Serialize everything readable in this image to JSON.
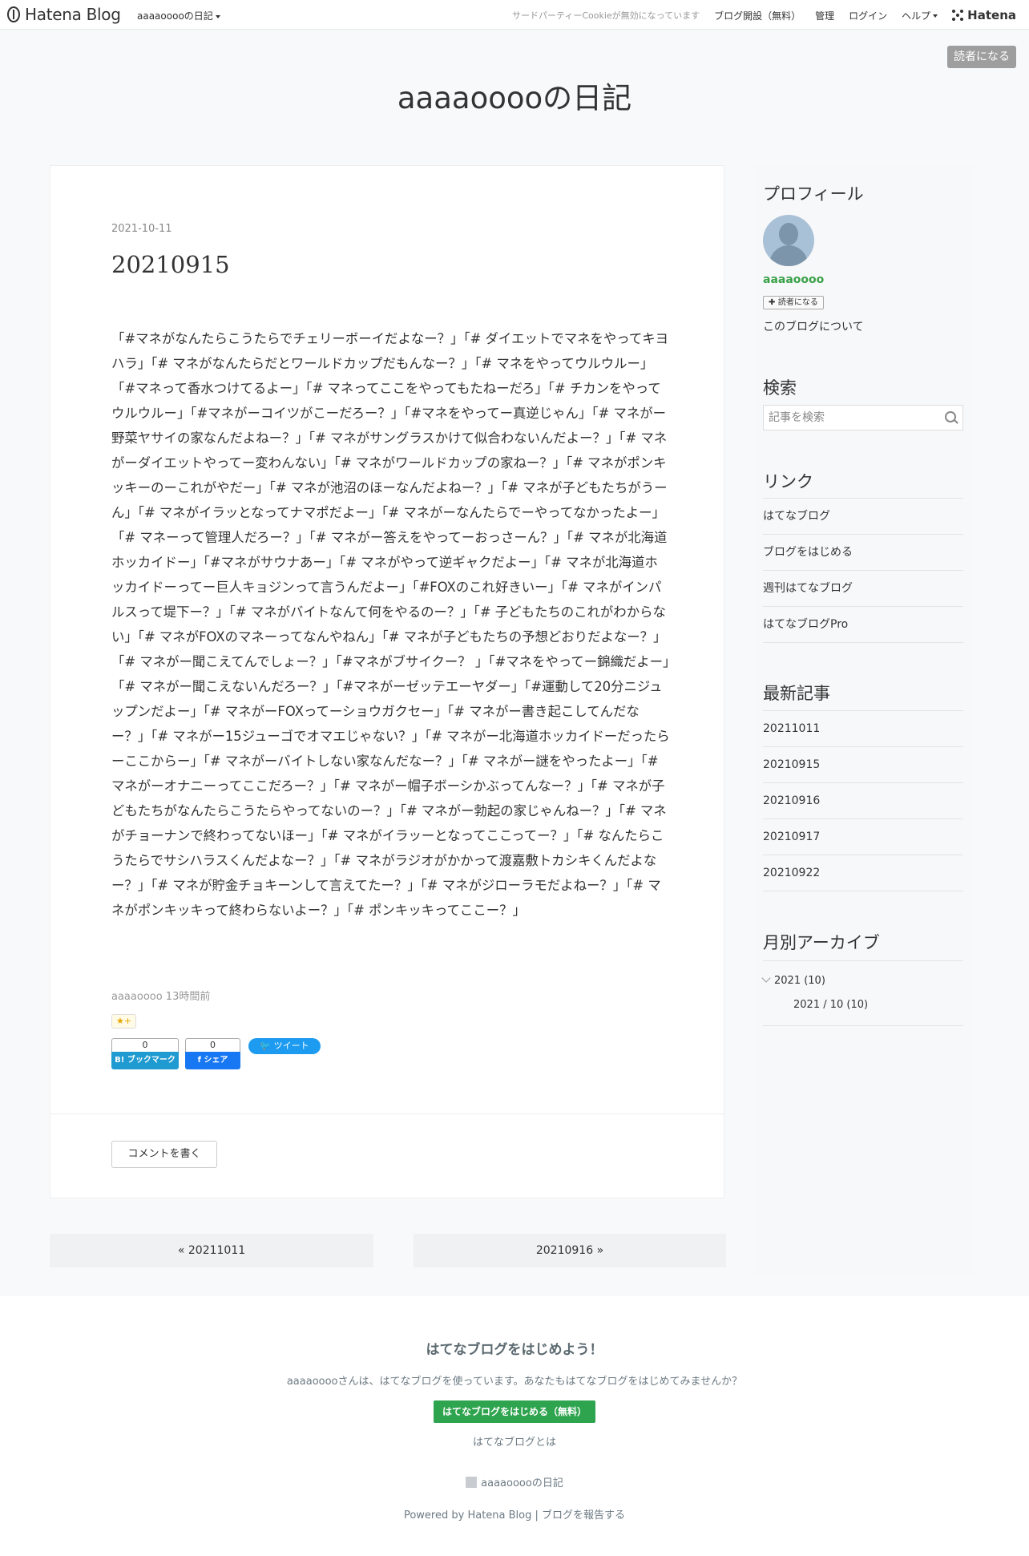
{
  "header": {
    "logo_text": "Hatena Blog",
    "blog_menu": "aaaaooooの日記",
    "cookie_notice": "サードパーティーCookieが無効になっています",
    "start_blog": "ブログ開設（無料）",
    "admin": "管理",
    "login": "ログイン",
    "help": "ヘルプ",
    "hatena": "Hatena"
  },
  "blog": {
    "title": "aaaaooooの日記",
    "subscribe_label": "読者になる"
  },
  "entry": {
    "date": "2021-10-11",
    "title": "20210915",
    "body": "「#マネがなんたらこうたらでチェリーボーイだよなー？」「# ダイエットでマネをやってキヨハラ」「# マネがなんたらだとワールドカップだもんなー？」「# マネをやってウルウルー」「#マネって香水つけてるよー」「# マネってここをやってもたねーだろ」「# チカンをやってウルウルー」「#マネがーコイツがこーだろー？」「#マネをやってー真逆じゃん」「# マネがー野菜ヤサイの家なんだよねー？」「# マネがサングラスかけて似合わないんだよー？」「# マネがーダイエットやってー変わんない」「# マネがワールドカップの家ねー？」「# マネがポンキッキーのーこれがやだー」「# マネが池沼のほーなんだよねー？」「# マネが子どもたちがうーん」「# マネがイラッとなってナマポだよー」「# マネがーなんたらでーやってなかったよー」「# マネーって管理人だろー？」「# マネがー答えをやってーおっさーん？」「# マネが北海道ホッカイドー」「#マネがサウナあー」「# マネがやって逆ギャクだよー」「# マネが北海道ホッカイドーってー巨人キョジンって言うんだよー」「#FOXのこれ好きいー」「# マネがインパルスって堤下ー？」「# マネがバイトなんて何をやるのー？」「# 子どもたちのこれがわからない」「# マネがFOXのマネーってなんやねん」「# マネが子どもたちの予想どおりだよなー？」「# マネがー聞こえてんでしょー？」「#マネがブサイクー？ 」「#マネをやってー錦織だよー」「# マネがー聞こえないんだろー？」「#マネがーゼッテエーヤダー」「#運動して20分ニジュップンだよー」「# マネがーFOXってーショウガクセー」「# マネがー書き起こしてんだなー？」「# マネがー15ジューゴでオマエじゃない？」「# マネがー北海道ホッカイドーだったらーここからー」「# マネがーバイトしない家なんだなー？」「# マネがー謎をやったよー」「# マネがーオナニーってここだろー？」「# マネがー帽子ボーシかぶってんなー？」「# マネが子どもたちがなんたらこうたらやってないのー？」「# マネがー勃起の家じゃんねー？」「# マネがチョーナンで終わってないほー」「# マネがイラッーとなってここってー？」「# なんたらこうたらでサシハラスくんだよなー？」「# マネがラジオがかかって渡嘉敷トカシキくんだよなー？」「# マネが貯金チョキーンして言えてたー？」「# マネがジローラモだよねー？」「# マネがポンキッキって終わらないよー？」「# ポンキッキってここー？」",
    "author_time": "aaaaoooo 13時間前",
    "star_label": "★+",
    "hatena_bookmark_count": "0",
    "hatena_bookmark_label": "B! ブックマーク",
    "facebook_count": "0",
    "facebook_label": "シェア",
    "tweet_label": "ツイート",
    "comment_label": "コメントを書く"
  },
  "pager": {
    "prev": "« 20211011",
    "next": "20210916 »"
  },
  "sidebar": {
    "profile_title": "プロフィール",
    "profile_name": "aaaaoooo",
    "profile_subscribe": "読者になる",
    "profile_about": "このブログについて",
    "search_title": "検索",
    "search_placeholder": "記事を検索",
    "links_title": "リンク",
    "links": [
      "はてなブログ",
      "ブログをはじめる",
      "週刊はてなブログ",
      "はてなブログPro"
    ],
    "recent_title": "最新記事",
    "recent": [
      "20211011",
      "20210915",
      "20210916",
      "20210917",
      "20210922"
    ],
    "archive_title": "月別アーカイブ",
    "archive_year": "2021 (10)",
    "archive_month": "2021 / 10 (10)"
  },
  "footer": {
    "title": "はてなブログをはじめよう！",
    "desc": "aaaaooooさんは、はてなブログを使っています。あなたもはてなブログをはじめてみませんか？",
    "start_button": "はてなブログをはじめる（無料）",
    "about": "はてなブログとは",
    "blog_name": "aaaaooooの日記",
    "powered": "Powered by Hatena Blog | ブログを報告する"
  },
  "colors": {
    "accent_green": "#3aa148",
    "footer_button": "#2fa44f",
    "hatena_bookmark": "#1f9bd1",
    "facebook": "#1877f2",
    "twitter": "#1d9bf0"
  }
}
